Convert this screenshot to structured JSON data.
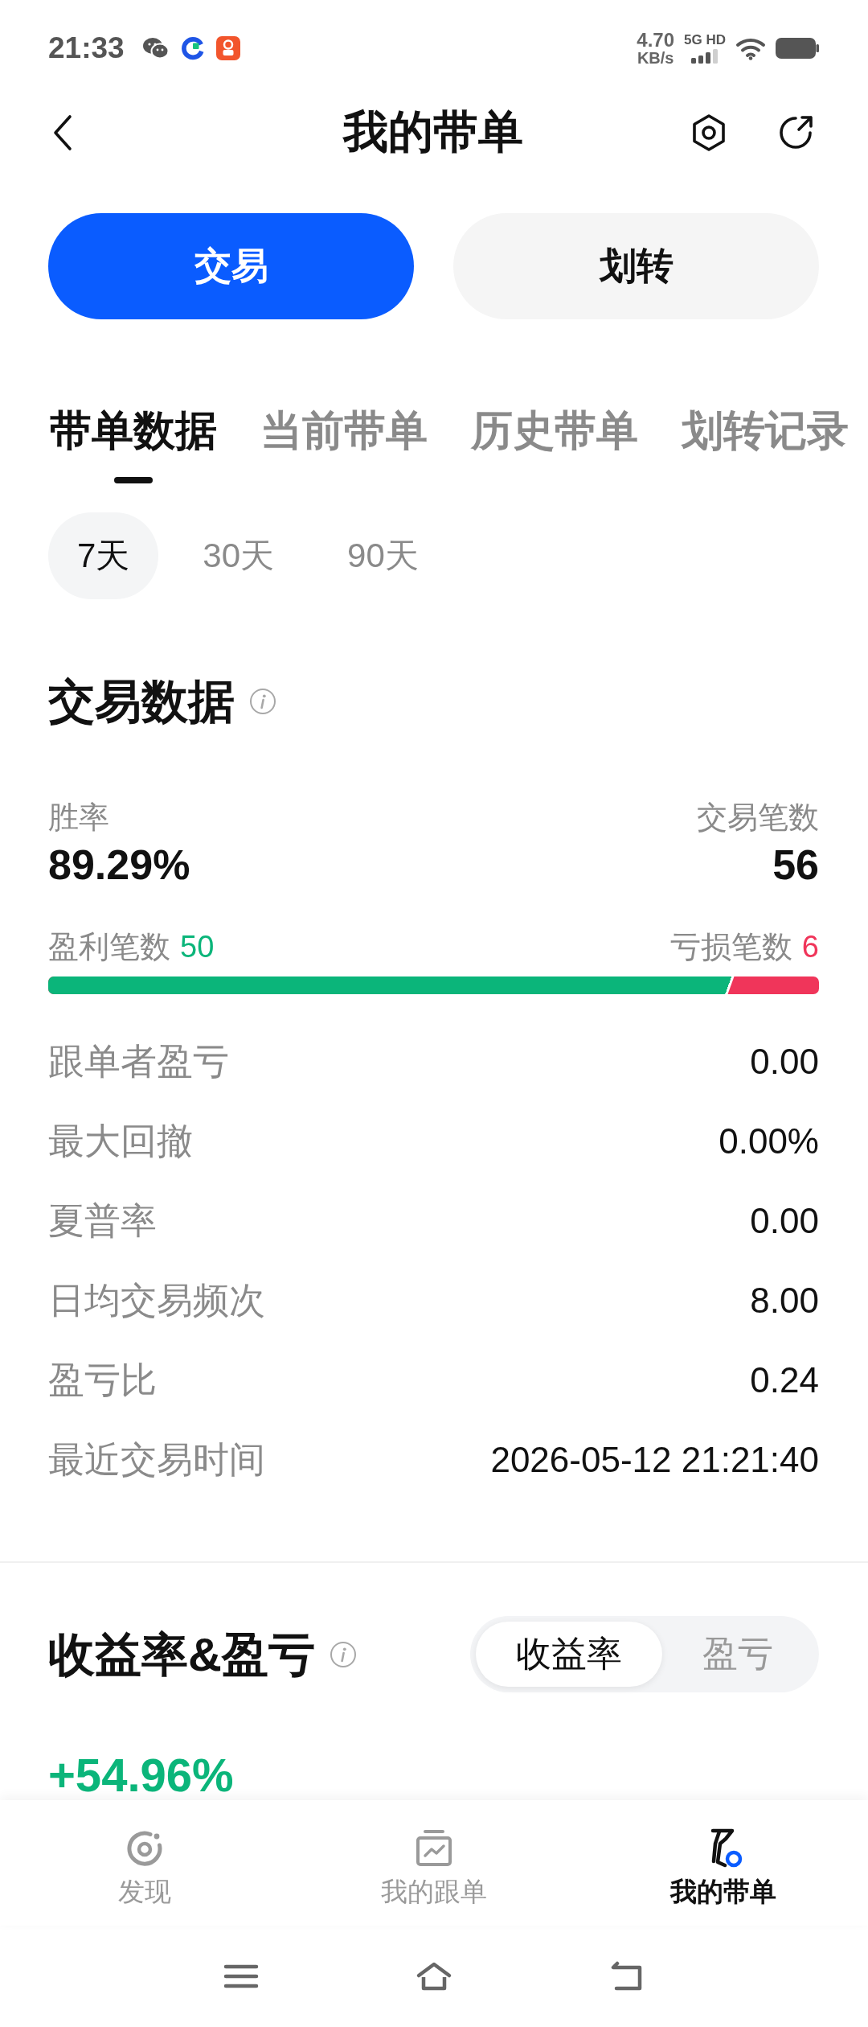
{
  "status_bar": {
    "time": "21:33",
    "net_speed": "4.70",
    "net_speed_unit": "KB/s",
    "network_type": "5G HD"
  },
  "header": {
    "title": "我的带单"
  },
  "mode_buttons": [
    {
      "label": "交易",
      "selected": true
    },
    {
      "label": "划转",
      "selected": false
    }
  ],
  "tabs": [
    {
      "label": "带单数据",
      "selected": true
    },
    {
      "label": "当前带单",
      "selected": false
    },
    {
      "label": "历史带单",
      "selected": false
    },
    {
      "label": "划转记录",
      "selected": false
    }
  ],
  "periods": [
    {
      "label": "7天",
      "selected": true
    },
    {
      "label": "30天",
      "selected": false
    },
    {
      "label": "90天",
      "selected": false
    }
  ],
  "trade_data": {
    "title": "交易数据",
    "win_rate": {
      "label": "胜率",
      "value": "89.29%"
    },
    "trade_count": {
      "label": "交易笔数",
      "value": "56"
    },
    "profit_count": {
      "label": "盈利笔数",
      "value": "50"
    },
    "loss_count": {
      "label": "亏损笔数",
      "value": "6"
    },
    "ratio_bar": {
      "level": 0.89
    },
    "rows": [
      {
        "label": "跟单者盈亏",
        "value": "0.00"
      },
      {
        "label": "最大回撤",
        "value": "0.00%"
      },
      {
        "label": "夏普率",
        "value": "0.00"
      },
      {
        "label": "日均交易频次",
        "value": "8.00"
      },
      {
        "label": "盈亏比",
        "value": "0.24"
      },
      {
        "label": "最近交易时间",
        "value": "2026-05-12 21:21:40"
      }
    ]
  },
  "returns": {
    "title": "收益率&盈亏",
    "toggle": [
      {
        "label": "收益率",
        "selected": true
      },
      {
        "label": "盈亏",
        "selected": false
      }
    ],
    "value": "+54.96%"
  },
  "bottom_nav": [
    {
      "label": "发现",
      "selected": false
    },
    {
      "label": "我的跟单",
      "selected": false
    },
    {
      "label": "我的带单",
      "selected": true
    }
  ]
}
